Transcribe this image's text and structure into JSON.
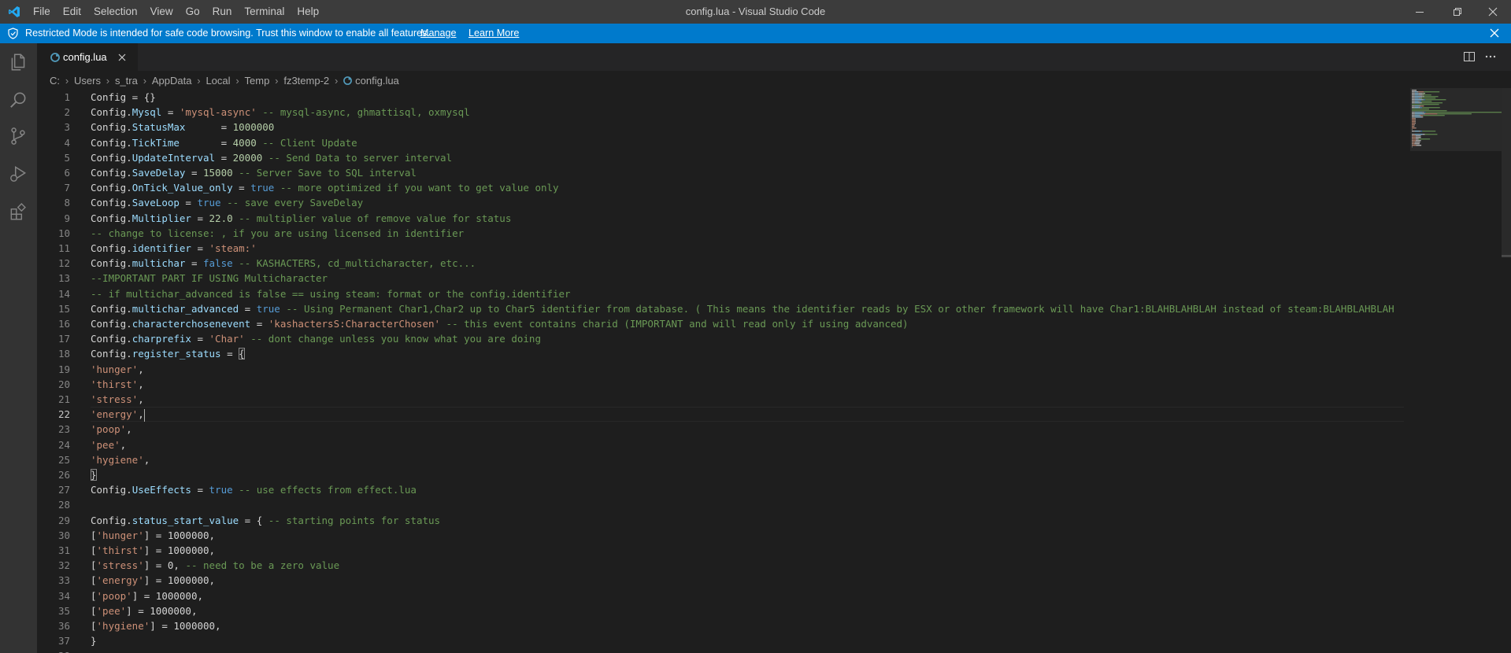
{
  "titlebar": {
    "menu": [
      "File",
      "Edit",
      "Selection",
      "View",
      "Go",
      "Run",
      "Terminal",
      "Help"
    ],
    "window_title": "config.lua - Visual Studio Code",
    "controls": [
      "minimize-icon",
      "restore-icon",
      "close-icon"
    ]
  },
  "banner": {
    "message": "Restricted Mode is intended for safe code browsing. Trust this window to enable all features.",
    "manage_label": "Manage",
    "learn_more_label": "Learn More"
  },
  "activitybar": {
    "items": [
      "explorer-icon",
      "search-icon",
      "source-control-icon",
      "run-debug-icon",
      "extensions-icon"
    ]
  },
  "tab": {
    "label": "config.lua",
    "icon": "lua-file-icon"
  },
  "breadcrumb": {
    "items": [
      "C:",
      "Users",
      "s_tra",
      "AppData",
      "Local",
      "Temp",
      "fz3temp-2",
      "config.lua"
    ]
  },
  "editor": {
    "current_line": 22,
    "lines": [
      [
        [
          "Config = {}",
          "d"
        ]
      ],
      [
        [
          "Config.",
          "d"
        ],
        [
          "Mysql",
          "p"
        ],
        [
          " = ",
          "d"
        ],
        [
          "'mysql-async'",
          "s"
        ],
        [
          " -- mysql-async, ghmattisql, oxmysql",
          "c"
        ]
      ],
      [
        [
          "Config.",
          "d"
        ],
        [
          "StatusMax",
          "p"
        ],
        [
          "      = ",
          "d"
        ],
        [
          "1000000",
          "n"
        ]
      ],
      [
        [
          "Config.",
          "d"
        ],
        [
          "TickTime",
          "p"
        ],
        [
          "       = ",
          "d"
        ],
        [
          "4000",
          "n"
        ],
        [
          " -- Client Update",
          "c"
        ]
      ],
      [
        [
          "Config.",
          "d"
        ],
        [
          "UpdateInterval",
          "p"
        ],
        [
          " = ",
          "d"
        ],
        [
          "20000",
          "n"
        ],
        [
          " -- Send Data to server interval",
          "c"
        ]
      ],
      [
        [
          "Config.",
          "d"
        ],
        [
          "SaveDelay",
          "p"
        ],
        [
          " = ",
          "d"
        ],
        [
          "15000",
          "n"
        ],
        [
          " -- Server Save to SQL interval",
          "c"
        ]
      ],
      [
        [
          "Config.",
          "d"
        ],
        [
          "OnTick_Value_only",
          "p"
        ],
        [
          " = ",
          "d"
        ],
        [
          "true",
          "k"
        ],
        [
          " -- more optimized if you want to get value only",
          "c"
        ]
      ],
      [
        [
          "Config.",
          "d"
        ],
        [
          "SaveLoop",
          "p"
        ],
        [
          " = ",
          "d"
        ],
        [
          "true",
          "k"
        ],
        [
          " -- save every SaveDelay",
          "c"
        ]
      ],
      [
        [
          "Config.",
          "d"
        ],
        [
          "Multiplier",
          "p"
        ],
        [
          " = ",
          "d"
        ],
        [
          "22.0",
          "n"
        ],
        [
          " -- multiplier value of remove value for status",
          "c"
        ]
      ],
      [
        [
          "-- change to license: , if you are using licensed in identifier",
          "c"
        ]
      ],
      [
        [
          "Config.",
          "d"
        ],
        [
          "identifier",
          "p"
        ],
        [
          " = ",
          "d"
        ],
        [
          "'steam:'",
          "s"
        ]
      ],
      [
        [
          "Config.",
          "d"
        ],
        [
          "multichar",
          "p"
        ],
        [
          " = ",
          "d"
        ],
        [
          "false",
          "k"
        ],
        [
          " -- KASHACTERS, cd_multicharacter, etc...",
          "c"
        ]
      ],
      [
        [
          "--IMPORTANT PART IF USING Multicharacter",
          "c"
        ]
      ],
      [
        [
          "-- if multichar_advanced is false == using steam: format or the config.identifier",
          "c"
        ]
      ],
      [
        [
          "Config.",
          "d"
        ],
        [
          "multichar_advanced",
          "p"
        ],
        [
          " = ",
          "d"
        ],
        [
          "true",
          "k"
        ],
        [
          " -- Using Permanent Char1,Char2 up to Char5 identifier from database. ( This means the identifier reads by ESX or other framework will have Char1:BLAHBLAHBLAH instead of steam:BLAHBLAHBLAH",
          "c"
        ]
      ],
      [
        [
          "Config.",
          "d"
        ],
        [
          "characterchosenevent",
          "p"
        ],
        [
          " = ",
          "d"
        ],
        [
          "'kashactersS:CharacterChosen'",
          "s"
        ],
        [
          " -- this event contains charid (IMPORTANT and will read only if using advanced)",
          "c"
        ]
      ],
      [
        [
          "Config.",
          "d"
        ],
        [
          "charprefix",
          "p"
        ],
        [
          " = ",
          "d"
        ],
        [
          "'Char'",
          "s"
        ],
        [
          " -- dont change unless you know what you are doing",
          "c"
        ]
      ],
      [
        [
          "Config.",
          "d"
        ],
        [
          "register_status",
          "p"
        ],
        [
          " = ",
          "d"
        ],
        [
          "{",
          "b"
        ]
      ],
      [
        [
          "'hunger'",
          "s"
        ],
        [
          ",",
          "d"
        ]
      ],
      [
        [
          "'thirst'",
          "s"
        ],
        [
          ",",
          "d"
        ]
      ],
      [
        [
          "'stress'",
          "s"
        ],
        [
          ",",
          "d"
        ]
      ],
      [
        [
          "'energy'",
          "s"
        ],
        [
          ",",
          "d"
        ]
      ],
      [
        [
          "'poop'",
          "s"
        ],
        [
          ",",
          "d"
        ]
      ],
      [
        [
          "'pee'",
          "s"
        ],
        [
          ",",
          "d"
        ]
      ],
      [
        [
          "'hygiene'",
          "s"
        ],
        [
          ",",
          "d"
        ]
      ],
      [
        [
          "}",
          "b"
        ]
      ],
      [
        [
          "Config.",
          "d"
        ],
        [
          "UseEffects",
          "p"
        ],
        [
          " = ",
          "d"
        ],
        [
          "true",
          "k"
        ],
        [
          " -- use effects from effect.lua",
          "c"
        ]
      ],
      [],
      [
        [
          "Config.",
          "d"
        ],
        [
          "status_start_value",
          "p"
        ],
        [
          " = { ",
          "d"
        ],
        [
          "-- starting points for status",
          "c"
        ]
      ],
      [
        [
          "[",
          "d"
        ],
        [
          "'hunger'",
          "s"
        ],
        [
          "] = 1000000,",
          "d"
        ]
      ],
      [
        [
          "[",
          "d"
        ],
        [
          "'thirst'",
          "s"
        ],
        [
          "] = 1000000,",
          "d"
        ]
      ],
      [
        [
          "[",
          "d"
        ],
        [
          "'stress'",
          "s"
        ],
        [
          "] = 0, ",
          "d"
        ],
        [
          "-- need to be a zero value",
          "c"
        ]
      ],
      [
        [
          "[",
          "d"
        ],
        [
          "'energy'",
          "s"
        ],
        [
          "] = 1000000,",
          "d"
        ]
      ],
      [
        [
          "[",
          "d"
        ],
        [
          "'poop'",
          "s"
        ],
        [
          "] = 1000000,",
          "d"
        ]
      ],
      [
        [
          "[",
          "d"
        ],
        [
          "'pee'",
          "s"
        ],
        [
          "] = 1000000,",
          "d"
        ]
      ],
      [
        [
          "[",
          "d"
        ],
        [
          "'hygiene'",
          "s"
        ],
        [
          "] = 1000000,",
          "d"
        ]
      ],
      [
        [
          "}",
          "d"
        ]
      ],
      []
    ]
  },
  "colors": {
    "d": "#d4d4d4",
    "p": "#9cdcfe",
    "s": "#ce9178",
    "c": "#6a9955",
    "n": "#b5cea8",
    "k": "#569cd6",
    "b": "#d4d4d4",
    "accent": "#007acc"
  }
}
